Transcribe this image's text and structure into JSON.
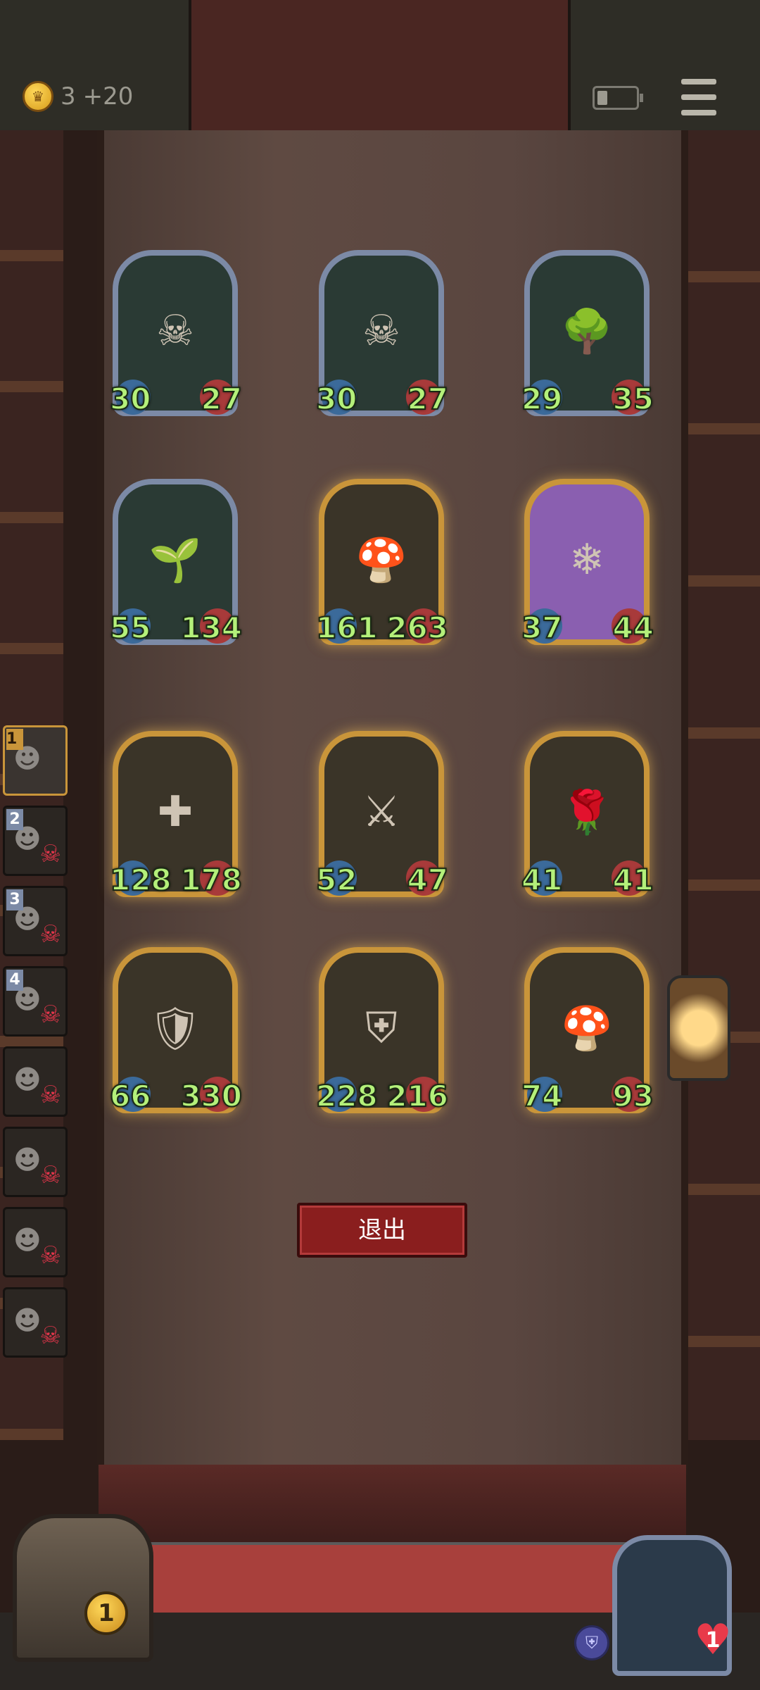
{
  "hud": {
    "gold_amount": "3",
    "gold_income": "+20",
    "battery_level": 0.25
  },
  "board": {
    "rows": [
      [
        {
          "name": "horned-elf-girl",
          "atk": "30",
          "hp": "27",
          "frame": "silver",
          "icon": "☠"
        },
        {
          "name": "horned-elf-girl",
          "atk": "30",
          "hp": "27",
          "frame": "silver",
          "icon": "☠"
        },
        {
          "name": "tree-monster",
          "atk": "29",
          "hp": "35",
          "frame": "silver",
          "icon": "🌳"
        }
      ],
      [
        {
          "name": "leaf-girl",
          "atk": "55",
          "hp": "134",
          "frame": "silver",
          "icon": "🌱"
        },
        {
          "name": "shadow-mushroom",
          "atk": "161",
          "hp": "263",
          "frame": "gold",
          "icon": "🍄"
        },
        {
          "name": "frost-yeti-mage",
          "atk": "37",
          "hp": "44",
          "frame": "purple",
          "icon": "❄"
        }
      ],
      [
        {
          "name": "stitched-giant",
          "atk": "128",
          "hp": "178",
          "frame": "gold",
          "icon": "✚"
        },
        {
          "name": "bearded-barbarian",
          "atk": "52",
          "hp": "47",
          "frame": "gold",
          "icon": "⚔"
        },
        {
          "name": "hooded-rose-sage",
          "atk": "41",
          "hp": "41",
          "frame": "gold",
          "icon": "🌹"
        }
      ],
      [
        {
          "name": "masked-warrior",
          "atk": "66",
          "hp": "330",
          "frame": "gold",
          "icon": "🛡"
        },
        {
          "name": "armored-knight",
          "atk": "228",
          "hp": "216",
          "frame": "gold",
          "icon": "⛨"
        },
        {
          "name": "shadow-mushroom",
          "atk": "74",
          "hp": "93",
          "frame": "gold",
          "icon": "🍄"
        }
      ]
    ]
  },
  "exit_button": {
    "label": "退出"
  },
  "lineup": [
    {
      "rank": "1",
      "status": "active"
    },
    {
      "rank": "2",
      "status": "dead"
    },
    {
      "rank": "3",
      "status": "dead"
    },
    {
      "rank": "4",
      "status": "dead"
    },
    {
      "rank": "",
      "status": "dead"
    },
    {
      "rank": "",
      "status": "dead"
    },
    {
      "rank": "",
      "status": "dead"
    },
    {
      "rank": "",
      "status": "dead"
    }
  ],
  "chest": {
    "count": "1"
  },
  "player": {
    "lives": "1"
  },
  "colors": {
    "stat_text": "#b4f07a",
    "exit_button": "#8a1e1e",
    "gold_frame": "#c9953a",
    "silver_frame": "#7c8aa6",
    "dead_skull": "#e2354a"
  }
}
